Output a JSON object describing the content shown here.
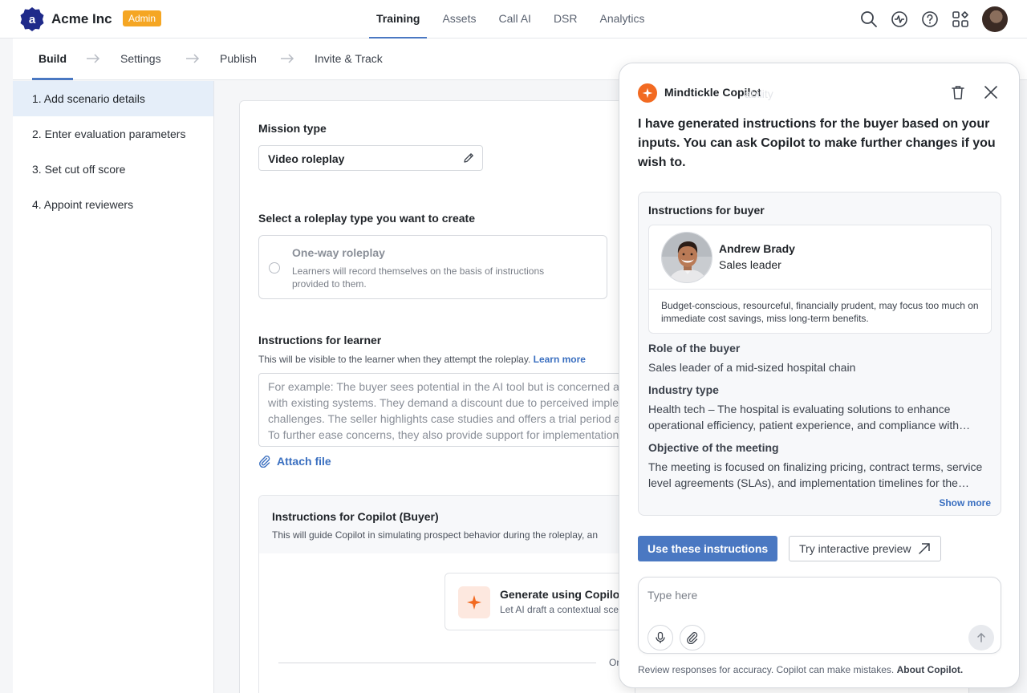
{
  "header": {
    "brand": "Acme Inc",
    "admin_badge": "Admin",
    "nav": [
      {
        "label": "Training",
        "active": true
      },
      {
        "label": "Assets",
        "active": false
      },
      {
        "label": "Call AI",
        "active": false
      },
      {
        "label": "DSR",
        "active": false
      },
      {
        "label": "Analytics",
        "active": false
      }
    ],
    "icons": [
      "search-icon",
      "activity-icon",
      "help-icon",
      "apps-icon"
    ]
  },
  "steps": [
    "Build",
    "Settings",
    "Publish",
    "Invite & Track"
  ],
  "sidebar": {
    "items": [
      "1. Add scenario details",
      "2. Enter evaluation parameters",
      "3. Set cut off score",
      "4. Appoint reviewers"
    ]
  },
  "form": {
    "mission_type_label": "Mission type",
    "mission_type_value": "Video roleplay",
    "roleplay_type_label": "Select a roleplay type you want to create",
    "option_title": "One-way roleplay",
    "option_desc": "Learners will record themselves on the basis of instructions provided to them.",
    "learner_label": "Instructions for learner",
    "learner_hint": "This will be visible to the learner when they attempt the roleplay.",
    "learn_more": "Learn more",
    "learner_placeholder": "For example: The buyer sees potential in the AI tool but is concerned about integrating it with existing systems. They demand a discount due to perceived implementation challenges. The seller highlights case studies and offers a trial period at a reduced cost. To further ease concerns, they also provide support for implementation.",
    "attach_file": "Attach file",
    "copilot_label": "Instructions for Copilot (Buyer)",
    "copilot_hint": "This will guide Copilot in simulating prospect behavior during the roleplay, an",
    "generate_title": "Generate using Copilot",
    "generate_desc": "Let AI draft a contextual scenario",
    "or_text": "Or"
  },
  "copilot": {
    "title": "Mindtickle Copilot",
    "ghost_text": "ability",
    "intro": "I have generated instructions for the buyer based on your inputs. You can ask Copilot to make further changes if you wish to.",
    "card_title": "Instructions for buyer",
    "persona": {
      "name": "Andrew Brady",
      "role": "Sales leader",
      "description": "Budget-conscious, resourceful, financially prudent, may focus too much on immediate cost savings, miss long-term benefits."
    },
    "sections": [
      {
        "title": "Role of the buyer",
        "text": "Sales leader of a mid-sized hospital chain"
      },
      {
        "title": "Industry type",
        "text": "Health tech – The hospital is evaluating solutions to enhance operational efficiency, patient experience, and compliance with healthcare regulations."
      },
      {
        "title": "Objective of the meeting",
        "text": "The meeting is focused on finalizing pricing, contract terms, service level agreements (SLAs), and implementation timelines for the solution."
      }
    ],
    "show_more": "Show more",
    "use_button": "Use these instructions",
    "preview_button": "Try interactive preview",
    "input_placeholder": "Type here",
    "disclaimer": "Review responses for accuracy. Copilot can make mistakes.",
    "about": "About Copilot."
  },
  "colors": {
    "accent": "#4a78c2",
    "admin_badge": "#f5a623",
    "copilot_orange": "#f26a21",
    "active_sidebar": "#e5eef9"
  }
}
